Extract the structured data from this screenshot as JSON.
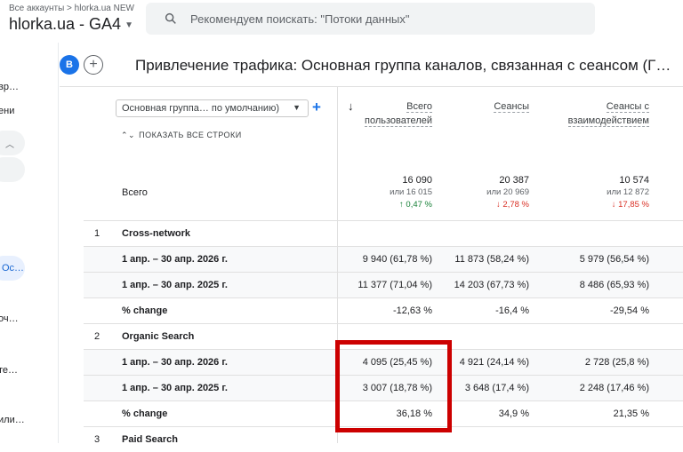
{
  "header": {
    "breadcrumb": "Все аккаунты > hlorka.ua NEW",
    "property": "hlorka.ua - GA4",
    "search_placeholder": "Рекомендуем поискать: \"Потоки данных\""
  },
  "sidebar": {
    "items": [
      "вр…",
      "ени",
      "Ос…",
      "оч…",
      "те…",
      "или…"
    ]
  },
  "page": {
    "avatar": "B",
    "title": "Привлечение трафика: Основная группа каналов, связанная с сеансом (Г…"
  },
  "table": {
    "dimension_select": "Основная группа… по умолчанию)",
    "show_all": "ПОКАЗАТЬ ВСЕ СТРОКИ",
    "columns": [
      {
        "line1": "Всего",
        "line2": "пользователей"
      },
      {
        "line1": "Сеансы",
        "line2": ""
      },
      {
        "line1": "Сеансы с",
        "line2": "взаимодействием"
      }
    ],
    "total_label": "Всего",
    "totals": [
      {
        "value": "16 090",
        "compare": "или 16 015",
        "change": "↑ 0,47 %",
        "dir": "up"
      },
      {
        "value": "20 387",
        "compare": "или 20 969",
        "change": "↓ 2,78 %",
        "dir": "down"
      },
      {
        "value": "10 574",
        "compare": "или 12 872",
        "change": "↓ 17,85 %",
        "dir": "down"
      }
    ],
    "rows": [
      {
        "num": "1",
        "label": "Cross-network",
        "cells": [
          "",
          "",
          ""
        ],
        "shade": false
      },
      {
        "num": "",
        "label": "1 апр. – 30 апр. 2026 г.",
        "cells": [
          "9 940 (61,78 %)",
          "11 873 (58,24 %)",
          "5 979 (56,54 %)"
        ],
        "shade": true
      },
      {
        "num": "",
        "label": "1 апр. – 30 апр. 2025 г.",
        "cells": [
          "11 377 (71,04 %)",
          "14 203 (67,73 %)",
          "8 486 (65,93 %)"
        ],
        "shade": true
      },
      {
        "num": "",
        "label": "% change",
        "cells": [
          "-12,63 %",
          "-16,4 %",
          "-29,54 %"
        ],
        "shade": false
      },
      {
        "num": "2",
        "label": "Organic Search",
        "cells": [
          "",
          "",
          ""
        ],
        "shade": false
      },
      {
        "num": "",
        "label": "1 апр. – 30 апр. 2026 г.",
        "cells": [
          "4 095 (25,45 %)",
          "4 921 (24,14 %)",
          "2 728 (25,8 %)"
        ],
        "shade": true
      },
      {
        "num": "",
        "label": "1 апр. – 30 апр. 2025 г.",
        "cells": [
          "3 007 (18,78 %)",
          "3 648 (17,4 %)",
          "2 248 (17,46 %)"
        ],
        "shade": true
      },
      {
        "num": "",
        "label": "% change",
        "cells": [
          "36,18 %",
          "34,9 %",
          "21,35 %"
        ],
        "shade": false
      },
      {
        "num": "3",
        "label": "Paid Search",
        "cells": [
          "",
          "",
          ""
        ],
        "shade": false
      }
    ]
  }
}
